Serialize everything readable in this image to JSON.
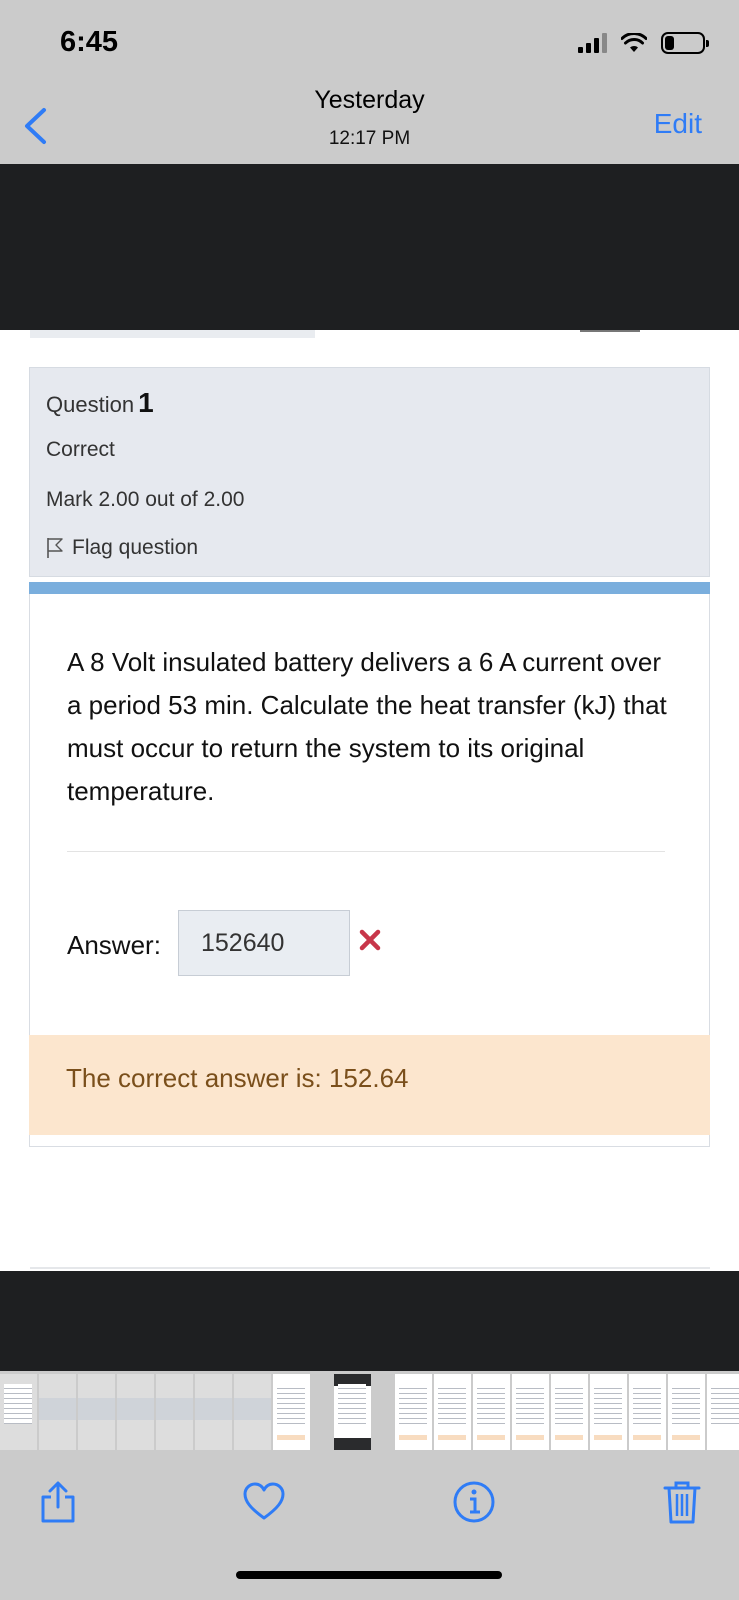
{
  "status_bar": {
    "time": "6:45"
  },
  "nav": {
    "title": "Yesterday",
    "subtitle": "12:17 PM",
    "edit_label": "Edit"
  },
  "question": {
    "label": "Question",
    "number": "1",
    "status": "Correct",
    "mark": "Mark 2.00 out of 2.00",
    "flag_label": "Flag question",
    "text": "A 8 Volt insulated battery delivers a 6 A current over a period 53 min. Calculate the heat transfer (kJ) that must occur to return the system to its original temperature.",
    "answer_label": "Answer:",
    "answer_value": "152640",
    "feedback": "The correct answer is: 152.64"
  },
  "colors": {
    "accent": "#2f7cf6",
    "blue_bar": "#7aaedd",
    "feedback_bg": "#fce6ce",
    "feedback_text": "#7a4f1b",
    "wrong_mark": "#c8364a"
  },
  "icons": {
    "back": "chevron-left-icon",
    "flag": "flag-icon",
    "wrong": "x-mark-icon",
    "share": "share-icon",
    "favorite": "heart-icon",
    "info": "info-icon",
    "delete": "trash-icon"
  }
}
